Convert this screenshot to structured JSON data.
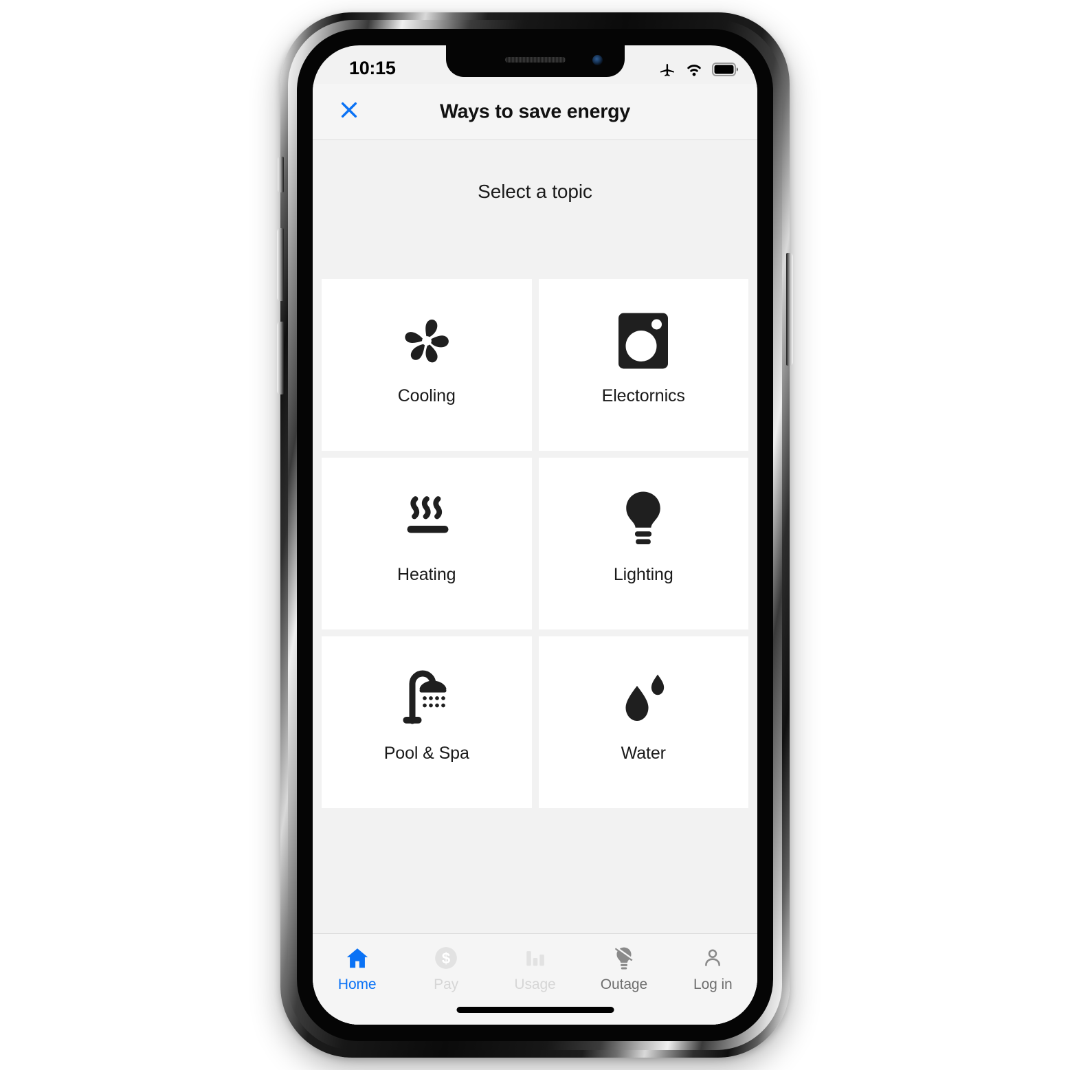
{
  "status_bar": {
    "time": "10:15",
    "icons": [
      "airplane-mode-icon",
      "wifi-icon",
      "battery-icon"
    ]
  },
  "header": {
    "close_icon": "close-icon",
    "title": "Ways to save energy"
  },
  "content": {
    "heading": "Select a topic",
    "topics": [
      {
        "label": "Cooling",
        "icon": "fan-icon"
      },
      {
        "label": "Electornics",
        "icon": "washing-machine-icon"
      },
      {
        "label": "Heating",
        "icon": "heat-waves-icon"
      },
      {
        "label": "Lighting",
        "icon": "light-bulb-icon"
      },
      {
        "label": "Pool & Spa",
        "icon": "shower-icon"
      },
      {
        "label": "Water",
        "icon": "water-drop-icon"
      }
    ]
  },
  "tab_bar": {
    "tabs": [
      {
        "label": "Home",
        "icon": "home-icon",
        "state": "active"
      },
      {
        "label": "Pay",
        "icon": "dollar-coin-icon",
        "state": "muted"
      },
      {
        "label": "Usage",
        "icon": "bar-chart-icon",
        "state": "muted"
      },
      {
        "label": "Outage",
        "icon": "bulb-off-icon",
        "state": "normal"
      },
      {
        "label": "Log in",
        "icon": "person-icon",
        "state": "normal"
      }
    ]
  },
  "colors": {
    "accent_blue": "#0a72f5",
    "screen_background": "#f2f2f2",
    "tile_background": "#ffffff",
    "icon_dark": "#1f1f1f",
    "tab_muted": "#d6d6d6",
    "tab_normal": "#6e6e6e"
  }
}
